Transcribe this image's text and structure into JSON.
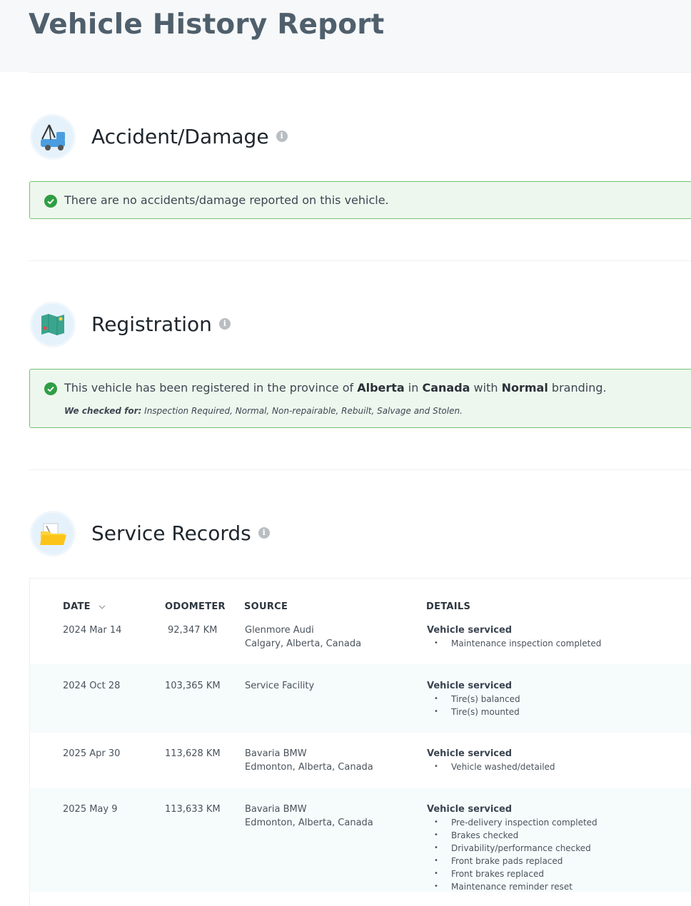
{
  "header": {
    "title": "Vehicle History Report"
  },
  "accident": {
    "title": "Accident/Damage",
    "message": "There are no accidents/damage reported on this vehicle."
  },
  "registration": {
    "title": "Registration",
    "message_prefix": "This vehicle has been registered in the province of ",
    "province": "Alberta",
    "message_mid1": " in ",
    "country": "Canada",
    "message_mid2": " with ",
    "branding": "Normal",
    "message_suffix": " branding.",
    "checked_label": "We checked for:",
    "checked_items": " Inspection Required, Normal, Non-repairable, Rebuilt, Salvage and Stolen."
  },
  "service": {
    "title": "Service Records",
    "columns": {
      "date": "DATE",
      "odometer": "ODOMETER",
      "source": "SOURCE",
      "details": "DETAILS"
    },
    "records": [
      {
        "date": "2024 Mar 14",
        "odometer": "92,347 KM",
        "source_line1": "Glenmore Audi",
        "source_line2": "Calgary, Alberta, Canada",
        "detail_title": "Vehicle serviced",
        "items": [
          "Maintenance inspection completed"
        ]
      },
      {
        "date": "2024 Oct 28",
        "odometer": "103,365 KM",
        "source_line1": "Service Facility",
        "source_line2": "",
        "detail_title": "Vehicle serviced",
        "items": [
          "Tire(s) balanced",
          "Tire(s) mounted"
        ]
      },
      {
        "date": "2025 Apr 30",
        "odometer": "113,628 KM",
        "source_line1": "Bavaria BMW",
        "source_line2": "Edmonton, Alberta, Canada",
        "detail_title": "Vehicle serviced",
        "items": [
          "Vehicle washed/detailed"
        ]
      },
      {
        "date": "2025 May 9",
        "odometer": "113,633 KM",
        "source_line1": "Bavaria BMW",
        "source_line2": "Edmonton, Alberta, Canada",
        "detail_title": "Vehicle serviced",
        "items": [
          "Pre-delivery inspection completed",
          "Brakes checked",
          "Drivability/performance checked",
          "Front brake pads replaced",
          "Front brakes replaced",
          "Maintenance reminder reset"
        ]
      }
    ]
  },
  "colors": {
    "success_bg": "#eef7ee",
    "success_border": "#74c274",
    "check": "#2f9e44",
    "title": "#4f5f6c"
  }
}
